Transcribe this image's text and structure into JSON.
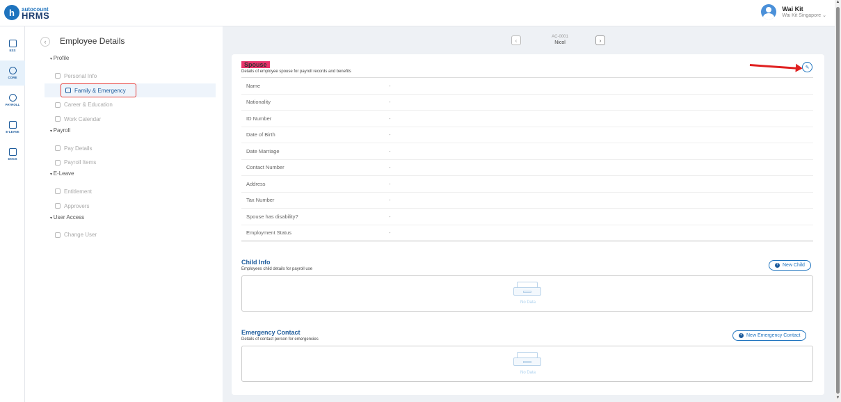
{
  "app": {
    "brand_small": "autocount",
    "brand_big": "HRMS"
  },
  "user": {
    "name": "Wai Kit",
    "company": "Wai Kit Singapore ⌄"
  },
  "rail": [
    {
      "label": "ESS",
      "icon": "calculator-icon"
    },
    {
      "label": "CORE",
      "icon": "cube-icon",
      "active": true
    },
    {
      "label": "PAYROLL",
      "icon": "dollar-icon"
    },
    {
      "label": "E-LEAVE",
      "icon": "calendar-icon"
    },
    {
      "label": "DOCS",
      "icon": "folder-icon"
    }
  ],
  "subnav": {
    "title": "Employee Details",
    "groups": [
      {
        "label": "Profile",
        "items": [
          "Personal Info",
          "Family & Emergency",
          "Career & Education",
          "Work Calendar"
        ]
      },
      {
        "label": "Payroll",
        "items": [
          "Pay Details",
          "Payroll Items"
        ]
      },
      {
        "label": "E-Leave",
        "items": [
          "Entitlement",
          "Approvers"
        ]
      },
      {
        "label": "User Access",
        "items": [
          "Change User"
        ]
      }
    ]
  },
  "employee": {
    "code": "AC-0001",
    "name": "Nicol"
  },
  "spouse": {
    "title": "Spouse",
    "subtitle": "Details of employee spouse for payroll records and benefits",
    "fields": [
      {
        "label": "Name",
        "value": "-"
      },
      {
        "label": "Nationality",
        "value": "-"
      },
      {
        "label": "ID Number",
        "value": "-"
      },
      {
        "label": "Date of Birth",
        "value": "-"
      },
      {
        "label": "Date Marriage",
        "value": "-"
      },
      {
        "label": "Contact Number",
        "value": "-"
      },
      {
        "label": "Address",
        "value": "-"
      },
      {
        "label": "Tax Number",
        "value": "-"
      },
      {
        "label": "Spouse has disability?",
        "value": "-"
      },
      {
        "label": "Employment Status",
        "value": "-"
      }
    ]
  },
  "child": {
    "title": "Child Info",
    "subtitle": "Employees child details for payroll use",
    "button": "New Child",
    "empty": "No Data"
  },
  "emergency": {
    "title": "Emergency Contact",
    "subtitle": "Details of contact person for emergencies",
    "button": "New Emergency Contact",
    "empty": "No Data"
  },
  "colors": {
    "accent": "#1e73be",
    "highlight": "#e8336b",
    "annotation": "#e02020"
  }
}
